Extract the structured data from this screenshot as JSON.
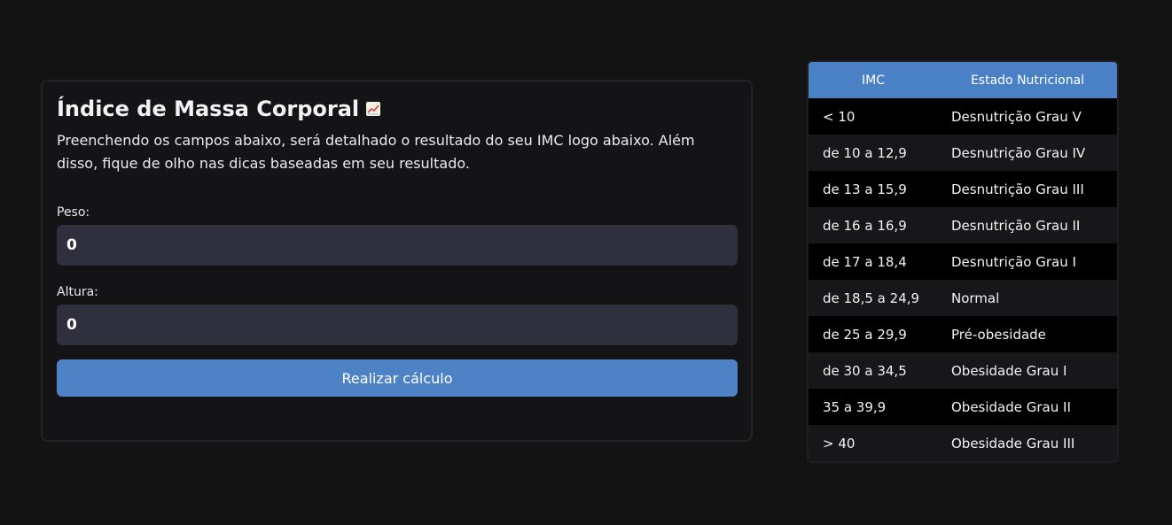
{
  "form": {
    "title": "Índice de Massa Corporal",
    "title_icon": "chart-increasing-icon",
    "description": "Preenchendo os campos abaixo, será detalhado o resultado do seu IMC logo abaixo. Além disso, fique de olho nas dicas baseadas em seu resultado.",
    "weight_label": "Peso:",
    "weight_value": "0",
    "height_label": "Altura:",
    "height_value": "0",
    "submit_label": "Realizar cálculo"
  },
  "table": {
    "headers": [
      "IMC",
      "Estado Nutricional"
    ],
    "rows": [
      [
        "< 10",
        "Desnutrição Grau V"
      ],
      [
        "de 10 a 12,9",
        "Desnutrição Grau IV"
      ],
      [
        "de 13 a 15,9",
        "Desnutrição Grau III"
      ],
      [
        "de 16 a 16,9",
        "Desnutrição Grau II"
      ],
      [
        "de 17 a 18,4",
        "Desnutrição Grau I"
      ],
      [
        "de 18,5 a 24,9",
        "Normal"
      ],
      [
        "de 25 a 29,9",
        "Pré-obesidade"
      ],
      [
        "de 30 a 34,5",
        "Obesidade Grau I"
      ],
      [
        "35 a 39,9",
        "Obesidade Grau II"
      ],
      [
        "> 40",
        "Obesidade Grau III"
      ]
    ]
  },
  "colors": {
    "background": "#131314",
    "accent": "#4d82c7",
    "input_bg": "#302f3e"
  }
}
